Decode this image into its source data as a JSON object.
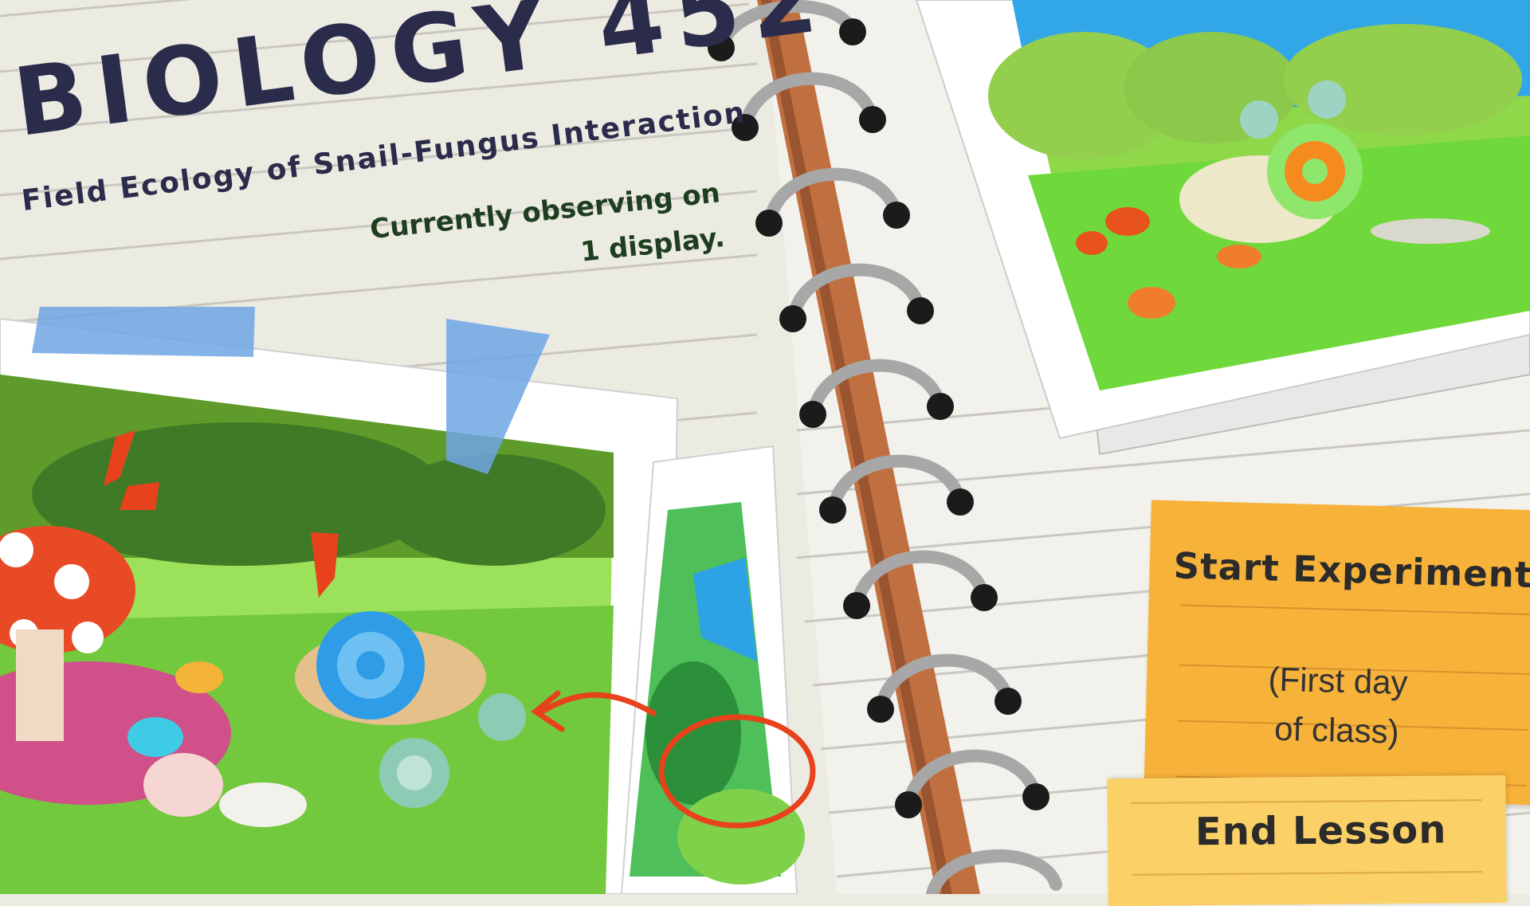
{
  "header": {
    "title": "BIOLOGY 452",
    "subtitle": "Field Ecology of Snail-Fungus Interaction",
    "status_line1": "Currently observing on",
    "status_line2": "1 display."
  },
  "actions": {
    "start_label": "Start Experiment",
    "start_sub_line1": "(First day",
    "start_sub_line2": "of class)",
    "end_label": "End Lesson"
  },
  "colors": {
    "ink": "#2b2c4b",
    "status_ink": "#1f3d1f",
    "sticky_orange": "#f7b23a",
    "sticky_yellow": "#fbd066",
    "spine": "#b5693b",
    "paper": "#ecebe2",
    "red_marker": "#e8421c"
  },
  "icons": [
    "spiral-ring-icon",
    "tape-icon",
    "snail-icon",
    "mushroom-icon",
    "arrow-icon",
    "circle-highlight-icon"
  ]
}
